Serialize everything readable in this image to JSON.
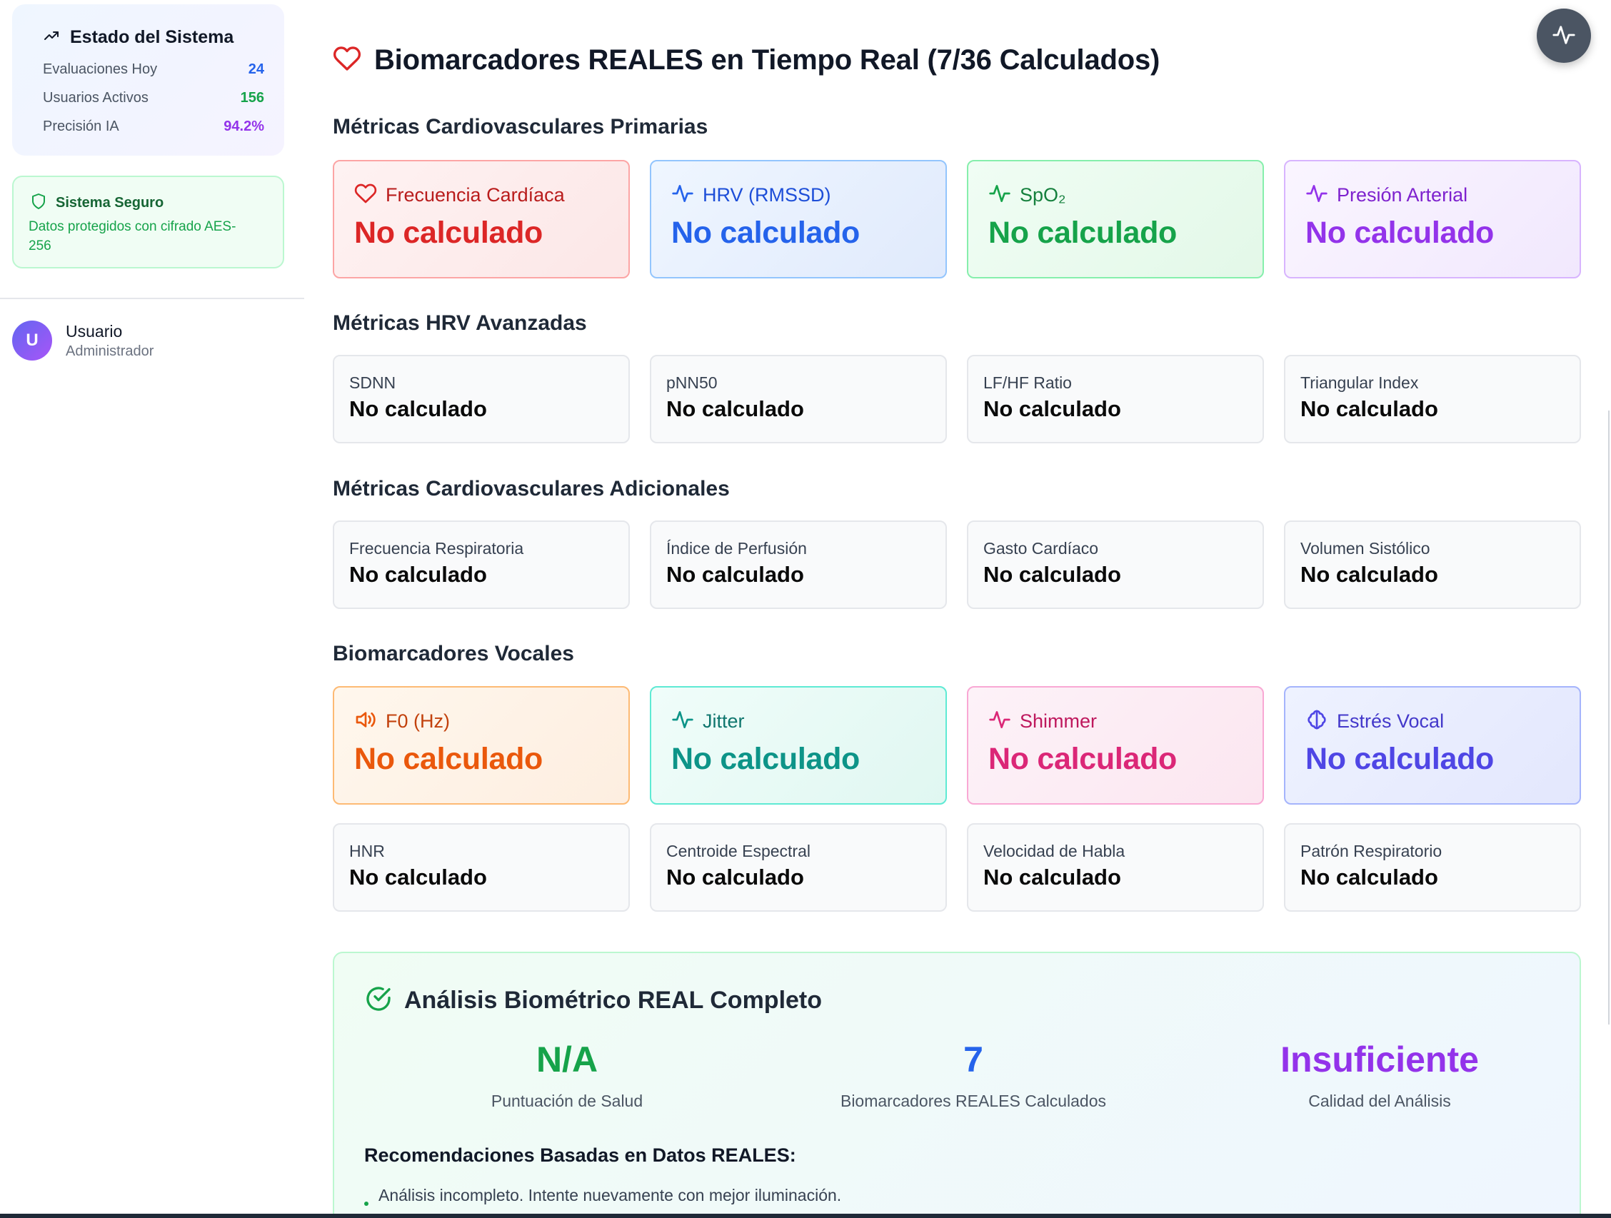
{
  "sidebar": {
    "status": {
      "title": "Estado del Sistema",
      "icon": "trending-up-icon",
      "stats": [
        {
          "label": "Evaluaciones Hoy",
          "value": "24",
          "color": "#2563eb"
        },
        {
          "label": "Usuarios Activos",
          "value": "156",
          "color": "#16a34a"
        },
        {
          "label": "Precisión IA",
          "value": "94.2%",
          "color": "#9333ea"
        }
      ]
    },
    "secure": {
      "title": "Sistema Seguro",
      "icon": "shield-icon",
      "text": "Datos protegidos con cifrado AES-256"
    },
    "user": {
      "initial": "U",
      "name": "Usuario",
      "role": "Administrador"
    }
  },
  "main": {
    "title": "Biomarcadores REALES en Tiempo Real (7/36 Calculados)",
    "title_icon": "heart-icon",
    "sections": {
      "primary": {
        "title": "Métricas Cardiovasculares Primarias",
        "cards": [
          {
            "label": "Frecuencia Cardíaca",
            "value": "No calculado",
            "icon": "heart-icon",
            "color": "#dc2626"
          },
          {
            "label": "HRV (RMSSD)",
            "value": "No calculado",
            "icon": "activity-icon",
            "color": "#2563eb"
          },
          {
            "label": "SpO₂",
            "value": "No calculado",
            "icon": "activity-icon",
            "color": "#16a34a"
          },
          {
            "label": "Presión Arterial",
            "value": "No calculado",
            "icon": "activity-icon",
            "color": "#9333ea"
          }
        ]
      },
      "hrv": {
        "title": "Métricas HRV Avanzadas",
        "cards": [
          {
            "label": "SDNN",
            "value": "No calculado"
          },
          {
            "label": "pNN50",
            "value": "No calculado"
          },
          {
            "label": "LF/HF Ratio",
            "value": "No calculado"
          },
          {
            "label": "Triangular Index",
            "value": "No calculado"
          }
        ]
      },
      "additional": {
        "title": "Métricas Cardiovasculares Adicionales",
        "cards": [
          {
            "label": "Frecuencia Respiratoria",
            "value": "No calculado"
          },
          {
            "label": "Índice de Perfusión",
            "value": "No calculado"
          },
          {
            "label": "Gasto Cardíaco",
            "value": "No calculado"
          },
          {
            "label": "Volumen Sistólico",
            "value": "No calculado"
          }
        ]
      },
      "vocal": {
        "title": "Biomarcadores Vocales",
        "cards": [
          {
            "label": "F0 (Hz)",
            "value": "No calculado",
            "icon": "volume-icon",
            "color": "#ea580c"
          },
          {
            "label": "Jitter",
            "value": "No calculado",
            "icon": "activity-icon",
            "color": "#0d9488"
          },
          {
            "label": "Shimmer",
            "value": "No calculado",
            "icon": "activity-icon",
            "color": "#db2777"
          },
          {
            "label": "Estrés Vocal",
            "value": "No calculado",
            "icon": "brain-icon",
            "color": "#4f46e5"
          }
        ],
        "extra_cards": [
          {
            "label": "HNR",
            "value": "No calculado"
          },
          {
            "label": "Centroide Espectral",
            "value": "No calculado"
          },
          {
            "label": "Velocidad de Habla",
            "value": "No calculado"
          },
          {
            "label": "Patrón Respiratorio",
            "value": "No calculado"
          }
        ]
      }
    },
    "summary": {
      "title": "Análisis Biométrico REAL Completo",
      "icon": "check-circle-icon",
      "stats": [
        {
          "value": "N/A",
          "label": "Puntuación de Salud",
          "color": "#16a34a"
        },
        {
          "value": "7",
          "label": "Biomarcadores REALES Calculados",
          "color": "#2563eb"
        },
        {
          "value": "Insuficiente",
          "label": "Calidad del Análisis",
          "color": "#9333ea"
        }
      ],
      "recommendations_title": "Recomendaciones Basadas en Datos REALES:",
      "recommendations": [
        "Análisis incompleto. Intente nuevamente con mejor iluminación."
      ]
    },
    "fab_icon": "activity-icon"
  }
}
